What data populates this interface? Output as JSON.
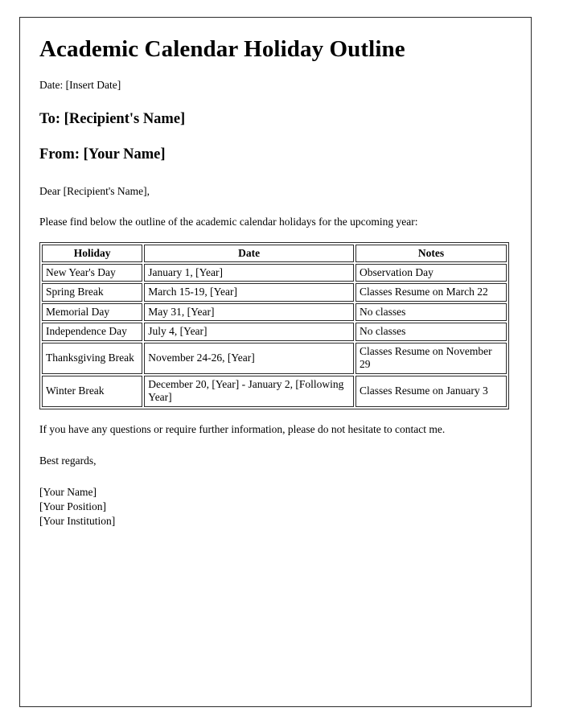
{
  "document": {
    "title": "Academic Calendar Holiday Outline",
    "date_line": "Date: [Insert Date]",
    "to_line": "To: [Recipient's Name]",
    "from_line": "From: [Your Name]",
    "salutation": "Dear [Recipient's Name],",
    "intro_paragraph": "Please find below the outline of the academic calendar holidays for the upcoming year:",
    "closing_paragraph": "If you have any questions or require further information, please do not hesitate to contact me.",
    "regards": "Best regards,",
    "signature": {
      "name": "[Your Name]",
      "position": "[Your Position]",
      "institution": "[Your Institution]"
    }
  },
  "table": {
    "headers": [
      "Holiday",
      "Date",
      "Notes"
    ],
    "rows": [
      {
        "holiday": "New Year's Day",
        "date": "January 1, [Year]",
        "notes": "Observation Day"
      },
      {
        "holiday": "Spring Break",
        "date": "March 15-19, [Year]",
        "notes": "Classes Resume on March 22"
      },
      {
        "holiday": "Memorial Day",
        "date": "May 31, [Year]",
        "notes": "No classes"
      },
      {
        "holiday": "Independence Day",
        "date": "July 4, [Year]",
        "notes": "No classes"
      },
      {
        "holiday": "Thanksgiving Break",
        "date": "November 24-26, [Year]",
        "notes": "Classes Resume on November 29"
      },
      {
        "holiday": "Winter Break",
        "date": "December 20, [Year] - January 2, [Following Year]",
        "notes": "Classes Resume on January 3"
      }
    ]
  },
  "style": {
    "page_border_color": "#2b2b2b",
    "text_color": "#000000",
    "background_color": "#ffffff"
  }
}
